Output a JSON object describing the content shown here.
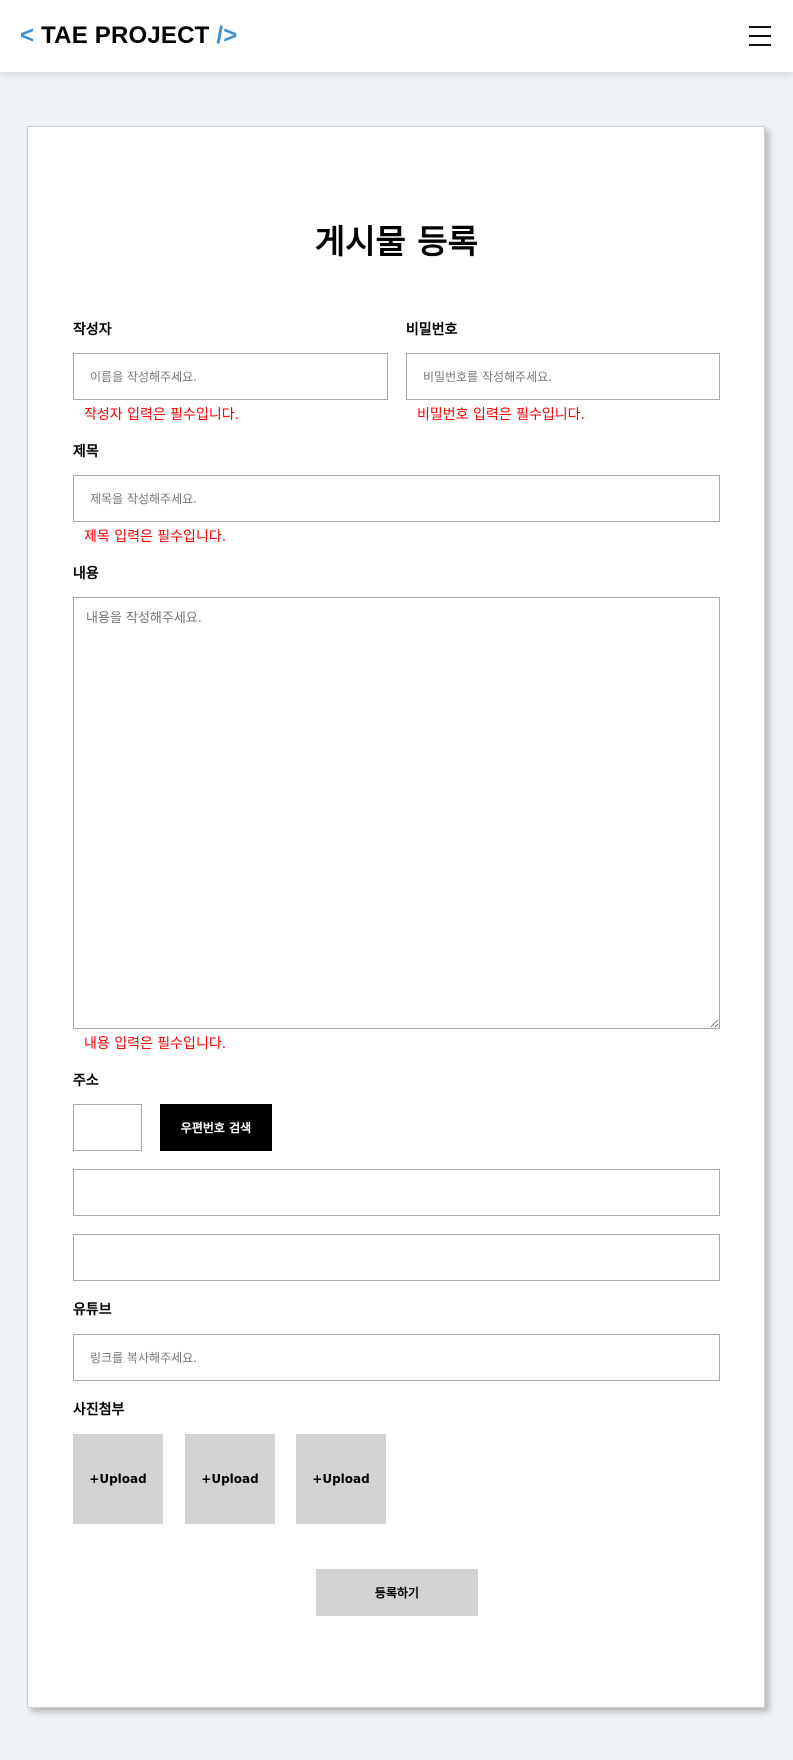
{
  "header": {
    "logo_open": "<",
    "logo_text": "TAE PROJECT",
    "logo_close": "/>",
    "menu_icon": "hamburger-icon"
  },
  "form": {
    "title": "게시물 등록",
    "writer": {
      "label": "작성자",
      "placeholder": "이름을 작성해주세요.",
      "error": "작성자 입력은 필수입니다."
    },
    "password": {
      "label": "비밀번호",
      "placeholder": "비밀번호를 작성해주세요.",
      "error": "비밀번호 입력은 필수입니다."
    },
    "subject": {
      "label": "제목",
      "placeholder": "제목을 작성해주세요.",
      "error": "제목 입력은 필수입니다."
    },
    "contents": {
      "label": "내용",
      "placeholder": "내용을 작성해주세요.",
      "error": "내용 입력은 필수입니다."
    },
    "address": {
      "label": "주소",
      "search_button": "우편번호 검색"
    },
    "youtube": {
      "label": "유튜브",
      "placeholder": "링크를 복사해주세요."
    },
    "photos": {
      "label": "사진첨부",
      "upload_label": "+Upload"
    },
    "submit_label": "등록하기"
  },
  "colors": {
    "accent": "#3a90d0",
    "error": "#ff0000",
    "page_bg": "#f0f3f6",
    "button_gray": "#d3d3d3"
  }
}
